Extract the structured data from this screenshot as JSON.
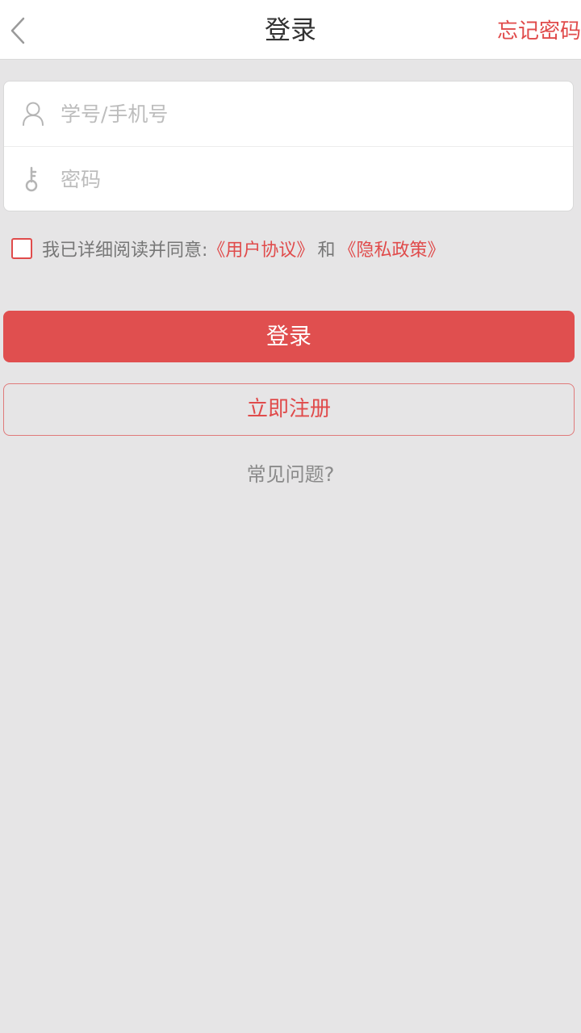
{
  "header": {
    "back_icon": "chevron-left-icon",
    "title": "登录",
    "forgot_password": "忘记密码"
  },
  "form": {
    "account": {
      "icon": "user-icon",
      "placeholder": "学号/手机号",
      "value": ""
    },
    "password": {
      "icon": "key-icon",
      "placeholder": "密码",
      "value": ""
    }
  },
  "agreement": {
    "checked": false,
    "prefix": "我已详细阅读并同意:",
    "user_agreement": "《用户协议》",
    "conjunction": "和",
    "privacy_policy": "《隐私政策》"
  },
  "actions": {
    "login_label": "登录",
    "register_label": "立即注册",
    "faq_label": "常见问题?"
  },
  "colors": {
    "accent": "#e04b4b",
    "background": "#e6e5e6"
  }
}
